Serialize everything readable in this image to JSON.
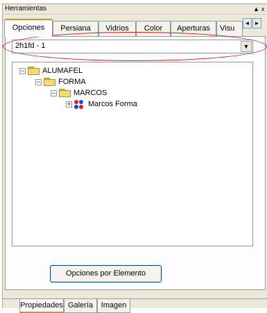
{
  "window": {
    "title": "Herramientas",
    "pin_glyph": "▲",
    "close_glyph": "x"
  },
  "tabs": [
    {
      "label": "Opciones"
    },
    {
      "label": "Persiana"
    },
    {
      "label": "Vidrios"
    },
    {
      "label": "Color"
    },
    {
      "label": "Aperturas"
    },
    {
      "label": "Visu"
    }
  ],
  "tab_scroll": {
    "left": "◄",
    "right": "►"
  },
  "combo": {
    "value": "2h1fd - 1",
    "arrow": "▼"
  },
  "tree": {
    "nodes": [
      {
        "label": "ALUMAFEL",
        "expander": "−"
      },
      {
        "label": "FORMA",
        "expander": "−"
      },
      {
        "label": "MARCOS",
        "expander": "−"
      },
      {
        "label": "Marcos Forma",
        "expander": "+"
      }
    ],
    "colors": {
      "folder": "#f4d97a",
      "dot_red": "#e01b1b",
      "dot_blue": "#1a3fd6"
    }
  },
  "button": {
    "label": "Opciones por Elemento"
  },
  "bottom_tabs": [
    {
      "label": "Propiedades"
    },
    {
      "label": "Galería"
    },
    {
      "label": "Imagen"
    }
  ],
  "colors": {
    "highlight": "#d61818",
    "tab_accent": "#e68b2c"
  }
}
